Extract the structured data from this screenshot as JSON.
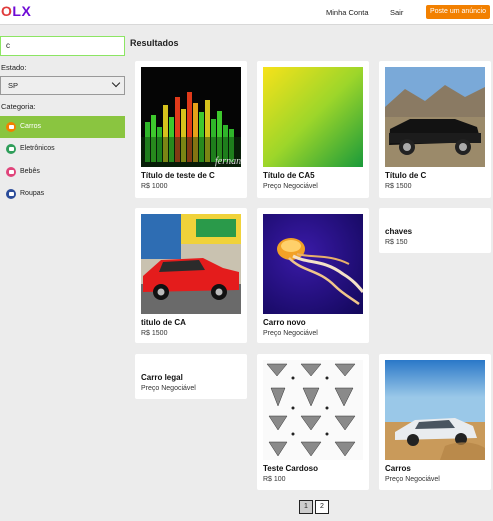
{
  "header": {
    "logo": {
      "o": "O",
      "l": "L",
      "x": "X"
    },
    "links": [
      "Minha Conta",
      "Sair"
    ],
    "post_button": "Poste um anúncio"
  },
  "sidebar": {
    "search_value": "c",
    "estado_label": "Estado:",
    "estado_value": "SP",
    "categoria_label": "Categoria:",
    "categories": [
      {
        "label": "Carros",
        "icon": "car-icon",
        "color": "#f28000",
        "active": true
      },
      {
        "label": "Eletrônicos",
        "icon": "monitor-icon",
        "color": "#2f9e5a",
        "active": false
      },
      {
        "label": "Bebês",
        "icon": "baby-icon",
        "color": "#e0457b",
        "active": false
      },
      {
        "label": "Roupas",
        "icon": "shirt-icon",
        "color": "#2b4c9a",
        "active": false
      }
    ]
  },
  "main": {
    "title": "Resultados",
    "items": [
      {
        "title": "Título de teste de C",
        "price": "R$ 1000",
        "image": "equalizer",
        "image_text": "fernan"
      },
      {
        "title": "Título de CA5",
        "price": "Preço Negociável",
        "image": "gradient"
      },
      {
        "title": "Título de C",
        "price": "R$ 1500",
        "image": "black-car"
      },
      {
        "title": "titulo de CA",
        "price": "R$ 1500",
        "image": "red-car"
      },
      {
        "title": "Carro novo",
        "price": "Preço Negociável",
        "image": "jellyfish"
      },
      {
        "title": "chaves",
        "price": "R$ 150",
        "image": null
      },
      {
        "title": "Carro legal",
        "price": "Preço Negociável",
        "image": null
      },
      {
        "title": "Teste Cardoso",
        "price": "R$ 100",
        "image": "origami"
      },
      {
        "title": "Carros",
        "price": "Preço Negociável",
        "image": "silver-car"
      }
    ],
    "pages": [
      "1",
      "2"
    ]
  },
  "colors": {
    "accent_orange": "#f28000",
    "accent_green": "#8ac540",
    "logo_purple": "#6e0ad6"
  }
}
